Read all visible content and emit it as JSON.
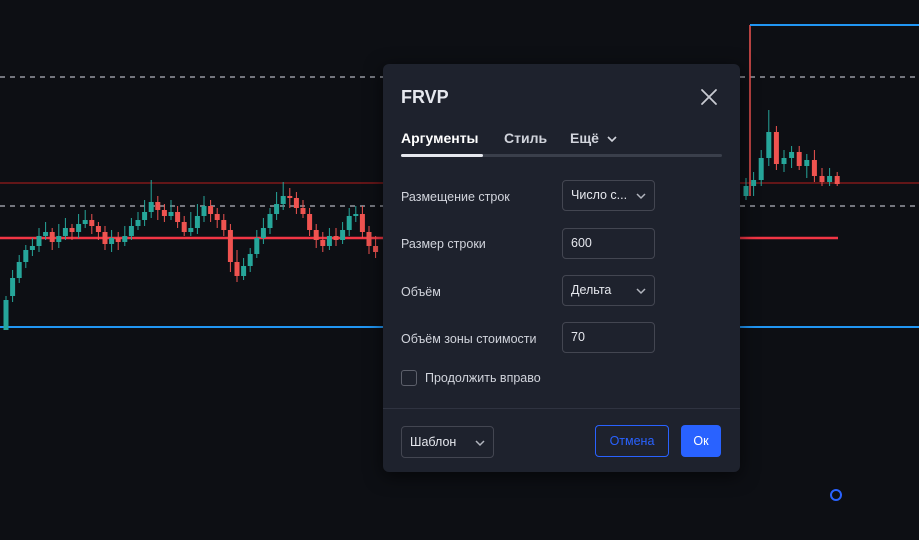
{
  "chart": {
    "colors": {
      "background": "#0d0f14",
      "up": "#26a69a",
      "down": "#ef5350",
      "poc": "#f23645",
      "value_area_bound": "#2196f3",
      "dashed": "#b2b5be"
    },
    "candles_left": [
      [
        330,
        300,
        296,
        316
      ],
      [
        296,
        278,
        270,
        302
      ],
      [
        278,
        262,
        255,
        283
      ],
      [
        262,
        250,
        245,
        268
      ],
      [
        250,
        246,
        238,
        256
      ],
      [
        246,
        236,
        228,
        252
      ],
      [
        236,
        232,
        222,
        240
      ],
      [
        232,
        242,
        228,
        250
      ],
      [
        242,
        236,
        224,
        248
      ],
      [
        236,
        228,
        218,
        240
      ],
      [
        228,
        232,
        224,
        240
      ],
      [
        232,
        224,
        214,
        238
      ],
      [
        224,
        220,
        210,
        228
      ],
      [
        220,
        226,
        214,
        234
      ],
      [
        226,
        232,
        222,
        240
      ],
      [
        232,
        244,
        226,
        250
      ],
      [
        244,
        238,
        230,
        252
      ],
      [
        238,
        242,
        232,
        250
      ],
      [
        242,
        236,
        226,
        246
      ],
      [
        236,
        226,
        218,
        240
      ],
      [
        226,
        220,
        212,
        230
      ],
      [
        220,
        212,
        200,
        226
      ],
      [
        212,
        202,
        180,
        218
      ],
      [
        202,
        210,
        196,
        220
      ],
      [
        210,
        216,
        204,
        222
      ],
      [
        216,
        212,
        200,
        220
      ],
      [
        212,
        222,
        206,
        228
      ],
      [
        222,
        232,
        216,
        236
      ],
      [
        232,
        228,
        212,
        236
      ],
      [
        228,
        216,
        204,
        234
      ],
      [
        216,
        206,
        196,
        222
      ],
      [
        206,
        214,
        200,
        222
      ],
      [
        214,
        220,
        208,
        228
      ],
      [
        220,
        230,
        214,
        236
      ],
      [
        230,
        262,
        224,
        272
      ],
      [
        262,
        276,
        250,
        282
      ],
      [
        276,
        266,
        258,
        280
      ],
      [
        266,
        254,
        248,
        272
      ],
      [
        254,
        238,
        230,
        258
      ],
      [
        238,
        228,
        218,
        244
      ],
      [
        228,
        214,
        208,
        234
      ],
      [
        214,
        204,
        192,
        220
      ],
      [
        204,
        196,
        182,
        210
      ],
      [
        196,
        198,
        188,
        208
      ],
      [
        198,
        208,
        192,
        214
      ],
      [
        208,
        214,
        200,
        218
      ],
      [
        214,
        230,
        208,
        236
      ],
      [
        230,
        240,
        224,
        248
      ],
      [
        240,
        246,
        232,
        252
      ],
      [
        246,
        236,
        228,
        250
      ],
      [
        236,
        240,
        228,
        246
      ],
      [
        240,
        230,
        222,
        244
      ],
      [
        230,
        216,
        208,
        236
      ],
      [
        216,
        214,
        206,
        222
      ],
      [
        214,
        232,
        206,
        238
      ],
      [
        232,
        246,
        226,
        254
      ],
      [
        246,
        252,
        236,
        258
      ]
    ],
    "candles_right": [
      [
        196,
        186,
        178,
        200
      ],
      [
        186,
        180,
        172,
        196
      ],
      [
        180,
        158,
        150,
        186
      ],
      [
        158,
        132,
        110,
        166
      ],
      [
        132,
        164,
        126,
        170
      ],
      [
        164,
        158,
        150,
        172
      ],
      [
        158,
        152,
        146,
        168
      ],
      [
        152,
        166,
        146,
        170
      ],
      [
        166,
        160,
        154,
        178
      ],
      [
        160,
        176,
        150,
        182
      ],
      [
        176,
        182,
        168,
        186
      ],
      [
        182,
        176,
        168,
        186
      ],
      [
        176,
        184,
        172,
        186
      ]
    ]
  },
  "dialog": {
    "title": "FRVP",
    "tabs": [
      "Аргументы",
      "Стиль",
      "Ещё"
    ],
    "row_placement_label": "Размещение строк",
    "row_placement_value": "Число с...",
    "row_size_label": "Размер строки",
    "row_size_value": "600",
    "volume_label": "Объём",
    "volume_value": "Дельта",
    "value_area_label": "Объём зоны стоимости",
    "value_area_value": "70",
    "extend_right_label": "Продолжить вправо",
    "extend_right_checked": false,
    "template_label": "Шаблон",
    "cancel_label": "Отмена",
    "ok_label": "Ок"
  }
}
